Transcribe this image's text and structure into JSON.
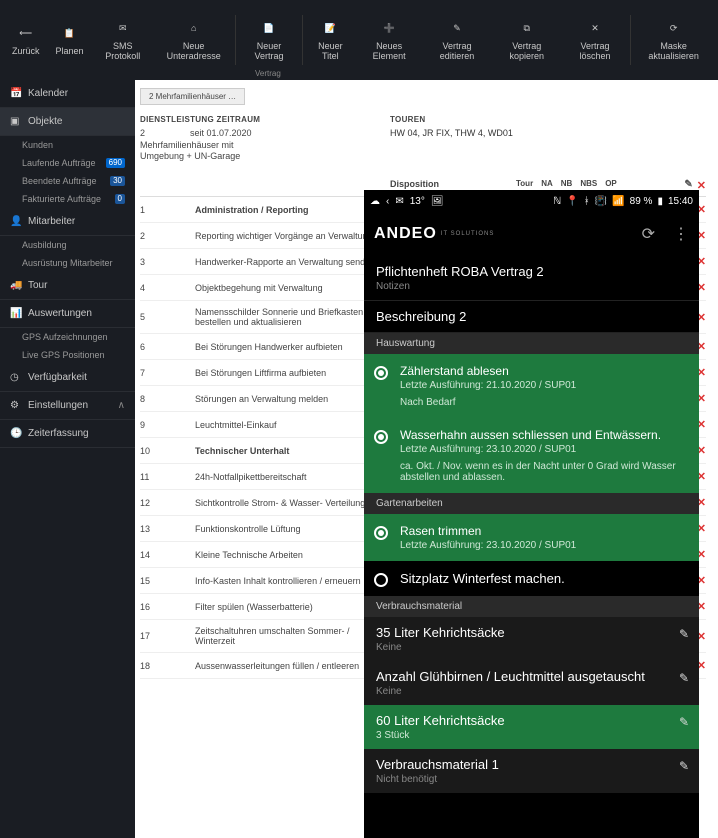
{
  "toolbar": {
    "items": [
      {
        "label": "Zurück",
        "icon": "back"
      },
      {
        "label": "Planen",
        "icon": "plan"
      },
      {
        "label": "SMS Protokoll",
        "icon": "sms"
      },
      {
        "label": "Neue Unteradresse",
        "icon": "addr"
      },
      {
        "label": "Neuer Vertrag",
        "icon": "doc"
      },
      {
        "label": "Neuer Titel",
        "icon": "title"
      },
      {
        "label": "Neues Element",
        "icon": "elem"
      },
      {
        "label": "Vertrag editieren",
        "icon": "edit"
      },
      {
        "label": "Vertrag kopieren",
        "icon": "copy"
      },
      {
        "label": "Vertrag löschen",
        "icon": "del"
      },
      {
        "label": "Maske aktualisieren",
        "icon": "refresh"
      }
    ],
    "group": "Vertrag"
  },
  "sidebar": {
    "sections": [
      {
        "label": "Kalender",
        "icon": "cal"
      },
      {
        "label": "Objekte",
        "icon": "obj",
        "active": true,
        "subs": [
          {
            "label": "Kunden"
          },
          {
            "label": "Laufende Aufträge",
            "badge": "690"
          },
          {
            "label": "Beendete Aufträge",
            "badge": "30"
          },
          {
            "label": "Fakturierte Aufträge",
            "badge": "0"
          }
        ]
      },
      {
        "label": "Mitarbeiter",
        "icon": "user",
        "subs": [
          {
            "label": "Ausbildung"
          },
          {
            "label": "Ausrüstung Mitarbeiter"
          }
        ]
      },
      {
        "label": "Tour",
        "icon": "tour"
      },
      {
        "label": "Auswertungen",
        "icon": "stats",
        "subs": [
          {
            "label": "GPS Aufzeichnungen"
          },
          {
            "label": "Live GPS Positionen"
          }
        ]
      },
      {
        "label": "Verfügbarkeit",
        "icon": "avail"
      },
      {
        "label": "Einstellungen",
        "icon": "gear",
        "chev": true
      },
      {
        "label": "Zeiterfassung",
        "icon": "time"
      }
    ]
  },
  "main": {
    "tab": "2 Mehrfamilienhäuser …",
    "dz_label": "DIENSTLEISTUNG ZEITRAUM",
    "dz_num": "2",
    "dz_text": "Mehrfamilienhäuser mit Umgebung + UN-Garage",
    "dz_since": "seit 01.07.2020",
    "touren_label": "TOUREN",
    "touren": "HW 04, JR FIX, THW 4, WD01",
    "cols": {
      "disp": "Disposition",
      "tour": "Tour",
      "na": "NA",
      "nb": "NB",
      "nbs": "NBS",
      "op": "OP"
    },
    "rows": [
      {
        "n": "1",
        "d": "Administration / Reporting",
        "bold": true
      },
      {
        "n": "2",
        "d": "Reporting wichtiger Vorgänge an Verwaltung"
      },
      {
        "n": "3",
        "d": "Handwerker-Rapporte an Verwaltung senden"
      },
      {
        "n": "4",
        "d": "Objektbegehung mit Verwaltung"
      },
      {
        "n": "5",
        "d": "Namensschilder Sonnerie und Briefkasten bestellen und aktualisieren"
      },
      {
        "n": "6",
        "d": "Bei Störungen Handwerker aufbieten"
      },
      {
        "n": "7",
        "d": "Bei Störungen Liftfirma aufbieten"
      },
      {
        "n": "8",
        "d": "Störungen an Verwaltung melden"
      },
      {
        "n": "9",
        "d": "Leuchtmittel-Einkauf"
      },
      {
        "n": "10",
        "d": "Technischer Unterhalt",
        "bold": true
      },
      {
        "n": "11",
        "d": "24h-Notfallpikettbereitschaft"
      },
      {
        "n": "12",
        "d": "Sichtkontrolle Strom- & Wasser- Verteilung"
      },
      {
        "n": "13",
        "d": "Funktionskontrolle Lüftung"
      },
      {
        "n": "14",
        "d": "Kleine Technische Arbeiten"
      },
      {
        "n": "15",
        "d": "Info-Kasten Inhalt kontrollieren / erneuern"
      },
      {
        "n": "16",
        "d": "Filter spülen (Wasserbatterie)"
      },
      {
        "n": "17",
        "d": "Zeitschaltuhren umschalten Sommer- / Winterzeit"
      },
      {
        "n": "18",
        "d": "Aussenwasserleitungen füllen / entleeren"
      }
    ]
  },
  "mobile": {
    "status": {
      "temp": "13°",
      "battery": "89 %",
      "time": "15:40"
    },
    "logo": "ANDEO",
    "logo_sub": "IT SOLUTIONS",
    "header": "Pflichtenheft ROBA Vertrag 2",
    "notizen": "Notizen",
    "beschreibung": "Beschreibung 2",
    "sec_hw": "Hauswartung",
    "hw": [
      {
        "t": "Zählerstand ablesen",
        "s": "Letzte Ausführung: 21.10.2020 / SUP01",
        "n": "Nach Bedarf",
        "on": true
      },
      {
        "t": "Wasserhahn aussen schliessen und Entwässern.",
        "s": "Letzte Ausführung: 23.10.2020 / SUP01",
        "n": "ca. Okt. / Nov. wenn es in der Nacht unter 0 Grad wird Wasser abstellen und ablassen.",
        "on": true
      }
    ],
    "sec_ga": "Gartenarbeiten",
    "ga": [
      {
        "t": "Rasen trimmen",
        "s": "Letzte Ausführung: 23.10.2020 / SUP01",
        "on": true,
        "green": true
      },
      {
        "t": "Sitzplatz Winterfest machen.",
        "on": false,
        "green": false
      }
    ],
    "sec_vm": "Verbrauchsmaterial",
    "vm": [
      {
        "t": "35 Liter Kehrichtsäcke",
        "s": "Keine"
      },
      {
        "t": "Anzahl Glühbirnen / Leuchtmittel ausgetauscht",
        "s": "Keine"
      },
      {
        "t": "60 Liter Kehrichtsäcke",
        "s": "3 Stück",
        "green": true
      },
      {
        "t": "Verbrauchsmaterial 1",
        "s": "Nicht benötigt"
      }
    ]
  }
}
